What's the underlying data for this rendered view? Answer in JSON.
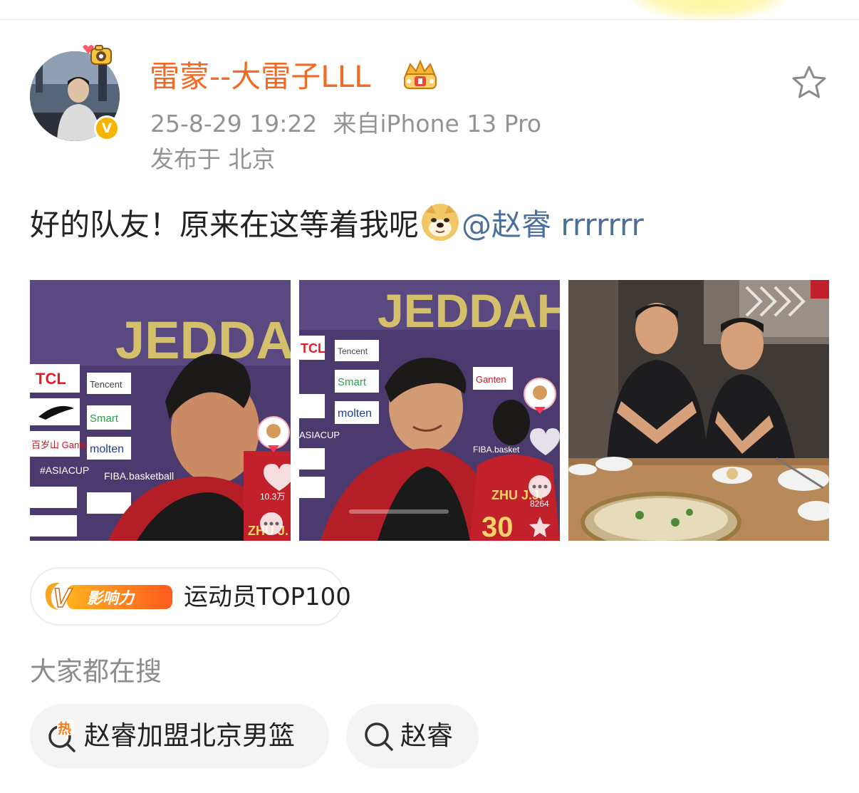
{
  "post": {
    "username": "雷蒙--大雷子LLL",
    "timestamp": "25-8-29 19:22",
    "source": "来自iPhone 13 Pro",
    "location": "发布于 北京",
    "text_before": "好的队友！原来在这等着我呢",
    "mention": "@赵睿 rrrrrrr",
    "verified_badge": "V"
  },
  "photos": [
    {
      "backdrop_text": "JEDDAH",
      "sponsors": [
        "TCL",
        "Tencent",
        "Smart",
        "百岁山 Ganten",
        "molten",
        "#ASIACUP",
        "FIBA.basketball"
      ],
      "likes": "10.3万"
    },
    {
      "backdrop_text": "JEDDAH",
      "sponsors": [
        "TCL",
        "Tencent",
        "Smart",
        "Ganten",
        "molten",
        "ASIACUP",
        "FIBA.basket"
      ],
      "jersey_text": "ZHU J.J.",
      "comments": "8264"
    },
    {
      "scene": "two men at a hotpot dinner table"
    }
  ],
  "influence": {
    "badge_label": "影响力",
    "badge_letter": "V",
    "rank_label": "运动员TOP100"
  },
  "search": {
    "heading": "大家都在搜",
    "hot_tag": "热",
    "chips": [
      {
        "label": "赵睿加盟北京男篮",
        "icon": "hot-search-icon"
      },
      {
        "label": "赵睿",
        "icon": "search-icon"
      }
    ]
  },
  "colors": {
    "username": "#f26a24",
    "meta": "#939393",
    "mention": "#4a6f9c",
    "chip_background": "#f4f4f4",
    "verified": "#f7b500"
  }
}
